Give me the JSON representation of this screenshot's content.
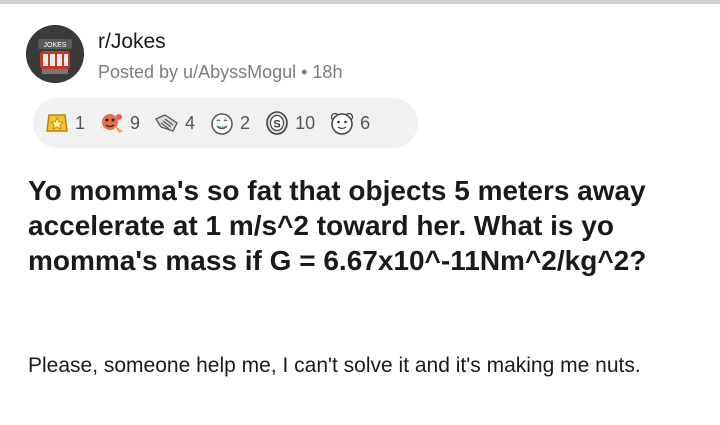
{
  "subreddit": "r/Jokes",
  "meta": {
    "posted_by": "Posted by u/AbyssMogul",
    "separator": "•",
    "age": "18h"
  },
  "awards": [
    {
      "icon": "gold-award-icon",
      "count": "1"
    },
    {
      "icon": "wholesome-seal-award-icon",
      "count": "9"
    },
    {
      "icon": "handshake-award-icon",
      "count": "4"
    },
    {
      "icon": "laughing-face-award-icon",
      "count": "2"
    },
    {
      "icon": "silver-coin-award-icon",
      "count": "10"
    },
    {
      "icon": "bear-face-award-icon",
      "count": "6"
    }
  ],
  "post": {
    "title": "Yo momma's so fat that objects 5 meters away accelerate at 1 m/s^2 toward her. What is yo momma's mass if G = 6.67x10^-11Nm^2/kg^2?",
    "body": "Please, someone help me, I can't solve it and it's making me nuts."
  },
  "colors": {
    "award_bar_bg": "#f1f1f2",
    "meta_text": "#7c7c7c",
    "title_text": "#1a1a1b"
  }
}
